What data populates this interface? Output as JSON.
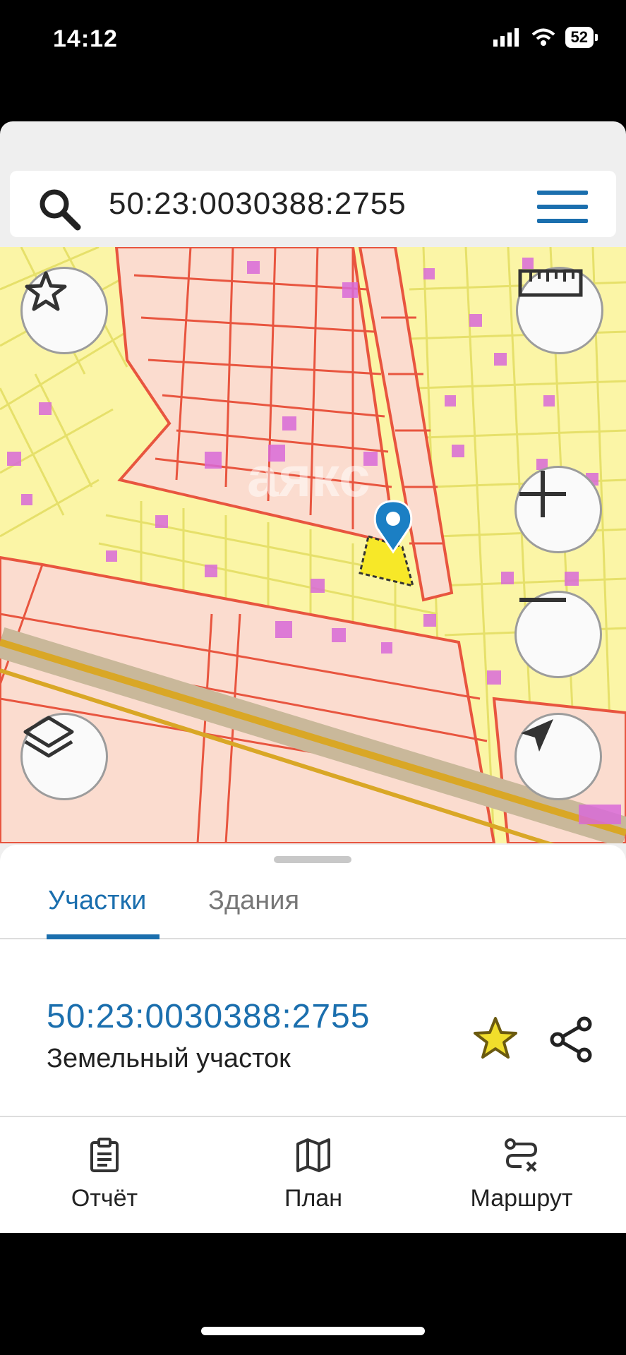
{
  "status_bar": {
    "time": "14:12",
    "battery": "52"
  },
  "search": {
    "query": "50:23:0030388:2755"
  },
  "map": {
    "watermark": "аякс"
  },
  "tabs": [
    {
      "label": "Участки",
      "active": true
    },
    {
      "label": "Здания",
      "active": false
    }
  ],
  "result": {
    "cadastral_number": "50:23:0030388:2755",
    "type": "Земельный участок",
    "favorite": true
  },
  "bottom_nav": [
    {
      "label": "Отчёт",
      "icon": "clipboard-icon"
    },
    {
      "label": "План",
      "icon": "map-icon"
    },
    {
      "label": "Маршрут",
      "icon": "route-icon"
    }
  ],
  "colors": {
    "accent": "#1b6fae",
    "parcel_stroke": "#e8553f",
    "parcel_fill": "#fbdccf",
    "map_yellow": "#fbf5a6",
    "building": "#d86ad8",
    "star": "#f1de2b"
  }
}
